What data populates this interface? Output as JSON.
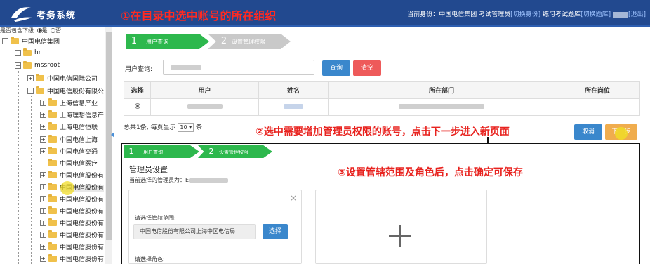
{
  "header": {
    "app_title": "考务系统",
    "annotation": "①在目录中选中账号的所在组织",
    "identity_prefix": "当前身份：",
    "identity": "中国电信集团 考试管理员",
    "switch_identity": "[切换身份]",
    "practice": "练习考试题库",
    "switch_bank": "[切换题库]",
    "logout": "[退出]"
  },
  "sidebar": {
    "filter_label": "是否包含下级",
    "filter_yes": "是",
    "filter_no": "否",
    "nodes": [
      {
        "label": "中国电信集团",
        "toggle": "−"
      },
      {
        "label": "hr",
        "toggle": "+"
      },
      {
        "label": "mssroot",
        "toggle": "−"
      },
      {
        "label": "中国电信国际公司",
        "toggle": "+"
      },
      {
        "label": "中国电信股份有限公",
        "toggle": "−"
      },
      {
        "label": "上海信息产业",
        "toggle": "+"
      },
      {
        "label": "上海理想信息产",
        "toggle": "+"
      },
      {
        "label": "上海电信恒联",
        "toggle": "+"
      },
      {
        "label": "中国电信上海",
        "toggle": "+"
      },
      {
        "label": "中国电信交通",
        "toggle": "+"
      },
      {
        "label": "中国电信医疗",
        "toggle": ""
      },
      {
        "label": "中国电信股份有",
        "toggle": "+"
      },
      {
        "label": "中国电信股份有",
        "toggle": "+"
      },
      {
        "label": "中国电信股份有",
        "toggle": "+"
      },
      {
        "label": "中国电信股份有",
        "toggle": "+"
      },
      {
        "label": "中国电信股份有",
        "toggle": "+"
      },
      {
        "label": "中国电信股份有",
        "toggle": "+"
      },
      {
        "label": "中国电信股份有",
        "toggle": "+"
      },
      {
        "label": "中国电信股份有",
        "toggle": "+"
      }
    ]
  },
  "steps": {
    "step1_num": "1",
    "step1_label": "用户查询",
    "step2_num": "2",
    "step2_label": "设置管理权限"
  },
  "search": {
    "label": "用户查询:",
    "query_button": "查询",
    "clear_button": "清空"
  },
  "table": {
    "headers": [
      "选择",
      "用户",
      "姓名",
      "所在部门",
      "所在岗位"
    ]
  },
  "pager": {
    "total": "总共1条,",
    "per_page_prefix": "每页显示",
    "per_page_value": "10",
    "per_page_suffix": "条"
  },
  "annotation_2": "②选中需要增加管理员权限的账号，点击下一步进入新页面",
  "cancel_button": "取消",
  "next_button": "下一步",
  "annotation_3": "③设置管辖范围及角色后，点击确定可保存",
  "admin": {
    "title": "管理员设置",
    "current_prefix": "当前选择的管理员为：E",
    "scope_label": "请选择管辖范围:",
    "scope_value": "中国电信股份有限公司上海中区电信局",
    "choose_button": "选择",
    "role_label": "请选择角色:"
  }
}
